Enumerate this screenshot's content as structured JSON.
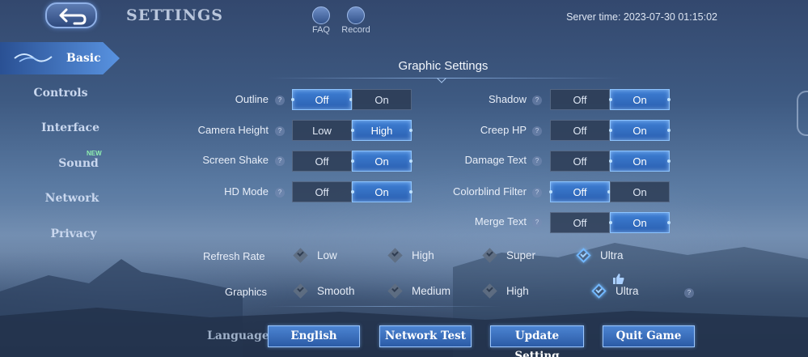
{
  "header": {
    "title": "SETTINGS",
    "faq_label": "FAQ",
    "record_label": "Record",
    "server_time": "Server time: 2023-07-30 01:15:02"
  },
  "nav": {
    "items": [
      {
        "label": "Basic",
        "active": true
      },
      {
        "label": "Controls"
      },
      {
        "label": "Interface"
      },
      {
        "label": "Sound",
        "badge": "NEW"
      },
      {
        "label": "Network"
      },
      {
        "label": "Privacy"
      }
    ]
  },
  "graphic": {
    "title": "Graphic Settings",
    "left": [
      {
        "label": "Outline",
        "options": [
          "Off",
          "On"
        ],
        "selected": "Off"
      },
      {
        "label": "Camera Height",
        "options": [
          "Low",
          "High"
        ],
        "selected": "High"
      },
      {
        "label": "Screen Shake",
        "options": [
          "Off",
          "On"
        ],
        "selected": "On"
      },
      {
        "label": "HD Mode",
        "options": [
          "Off",
          "On"
        ],
        "selected": "On"
      }
    ],
    "right": [
      {
        "label": "Shadow",
        "options": [
          "Off",
          "On"
        ],
        "selected": "On"
      },
      {
        "label": "Creep HP",
        "options": [
          "Off",
          "On"
        ],
        "selected": "On"
      },
      {
        "label": "Damage Text",
        "options": [
          "Off",
          "On"
        ],
        "selected": "On"
      },
      {
        "label": "Colorblind Filter",
        "options": [
          "Off",
          "On"
        ],
        "selected": "Off"
      },
      {
        "label": "Merge Text",
        "options": [
          "Off",
          "On"
        ],
        "selected": "On"
      }
    ],
    "refresh_rate": {
      "label": "Refresh Rate",
      "options": [
        "Low",
        "High",
        "Super",
        "Ultra"
      ],
      "selected": "Ultra"
    },
    "graphics": {
      "label": "Graphics",
      "options": [
        "Smooth",
        "Medium",
        "High",
        "Ultra"
      ],
      "selected": "Ultra"
    }
  },
  "footer": {
    "language_label": "Language",
    "language_value": "English",
    "network_test": "Network Test",
    "update_setting": "Update Setting",
    "quit_game": "Quit Game"
  },
  "colors": {
    "accent": "#3e7fd4",
    "accent_border": "#8cc4ff",
    "new_badge": "#8ff0b0"
  }
}
